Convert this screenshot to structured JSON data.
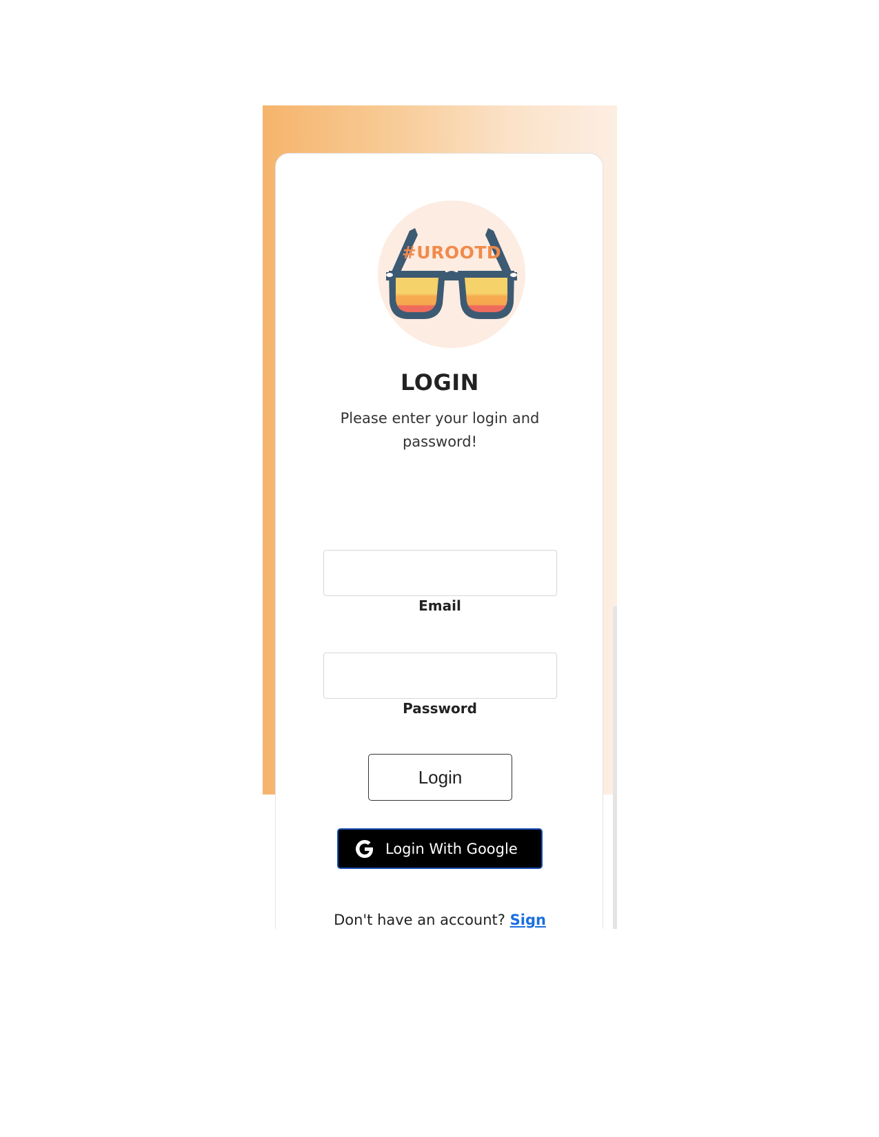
{
  "logo": {
    "text": "#UROOTD",
    "icon": "sunglasses-logo",
    "colors": {
      "circle": "#fdece1",
      "frame": "#3d5a73",
      "text": "#f08a4b",
      "lens_top": "#f5d26a",
      "lens_mid": "#f6a94f",
      "lens_bottom": "#ef6b5d"
    }
  },
  "title": "LOGIN",
  "subtitle": "Please enter your login and password!",
  "form": {
    "email": {
      "label": "Email",
      "value": "",
      "placeholder": ""
    },
    "password": {
      "label": "Password",
      "value": "",
      "placeholder": ""
    },
    "login_button": "Login",
    "google_button": {
      "label": "Login With Google",
      "icon": "google-g-icon"
    }
  },
  "footer": {
    "prompt": "Don't have an account?",
    "link": "Sign Up"
  },
  "colors": {
    "gradient_start": "#f5b46c",
    "gradient_end": "#fdeee3",
    "link": "#1a6fe0",
    "google_button_bg": "#000000",
    "google_button_border": "#1a4fb3"
  }
}
